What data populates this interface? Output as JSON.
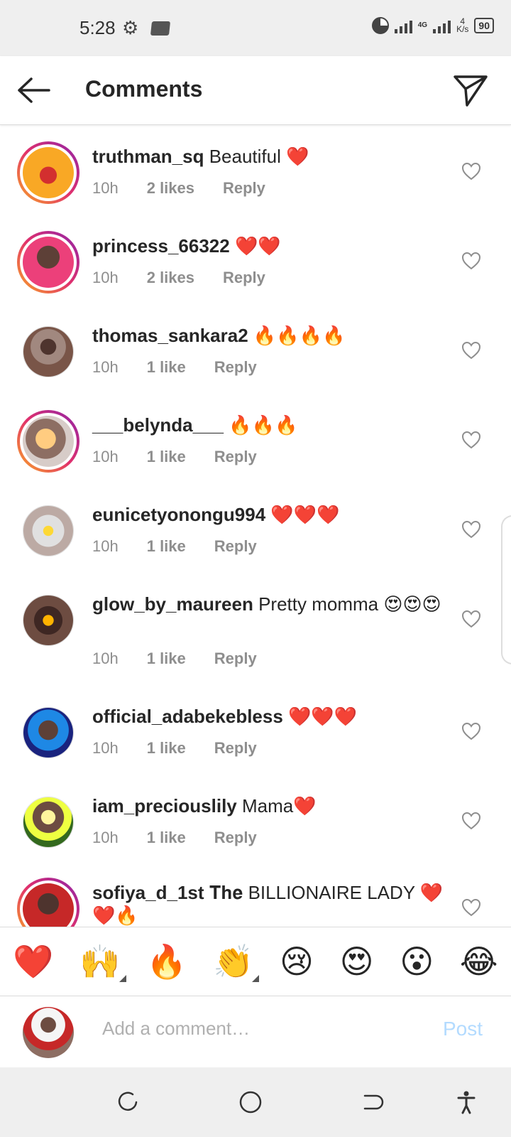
{
  "status_bar": {
    "time": "5:28",
    "network": "4G",
    "speed_value": "4",
    "speed_unit": "K/s",
    "battery": "90"
  },
  "header": {
    "title": "Comments"
  },
  "comments": [
    {
      "username": "truthman_sq",
      "text": "Beautiful ❤️",
      "time": "10h",
      "likes": "2 likes",
      "reply": "Reply"
    },
    {
      "username": "princess_66322",
      "text": "❤️❤️",
      "time": "10h",
      "likes": "2 likes",
      "reply": "Reply"
    },
    {
      "username": "thomas_sankara2",
      "text": "🔥🔥🔥🔥",
      "time": "10h",
      "likes": "1 like",
      "reply": "Reply"
    },
    {
      "username": "___belynda___",
      "text": "🔥🔥🔥",
      "time": "10h",
      "likes": "1 like",
      "reply": "Reply"
    },
    {
      "username": "eunicetyonongu994",
      "text": "❤️❤️❤️",
      "time": "10h",
      "likes": "1 like",
      "reply": "Reply"
    },
    {
      "username": "glow_by_maureen",
      "text": "Pretty momma 😍😍😍",
      "time": "10h",
      "likes": "1 like",
      "reply": "Reply"
    },
    {
      "username": "official_adabekebless",
      "text": "❤️❤️❤️",
      "time": "10h",
      "likes": "1 like",
      "reply": "Reply"
    },
    {
      "username": "iam_preciouslily",
      "text": "Mama❤️",
      "time": "10h",
      "likes": "1 like",
      "reply": "Reply"
    },
    {
      "username": "sofiya_d_1st",
      "text": "𝐓𝐡𝐞 BILLIONAIRE LADY ❤️❤️🔥",
      "time": "",
      "likes": "",
      "reply": ""
    }
  ],
  "emoji_bar": [
    "❤️",
    "🙌",
    "🔥",
    "👏",
    "😢",
    "😍",
    "😮",
    "😂"
  ],
  "composer": {
    "placeholder": "Add a comment…",
    "post_label": "Post"
  },
  "colors": {
    "text": "#262626",
    "meta": "#8e8e8e",
    "post_disabled": "#b3dbff",
    "story_ring_start": "#f9a825",
    "story_ring_end": "#8e24aa"
  }
}
